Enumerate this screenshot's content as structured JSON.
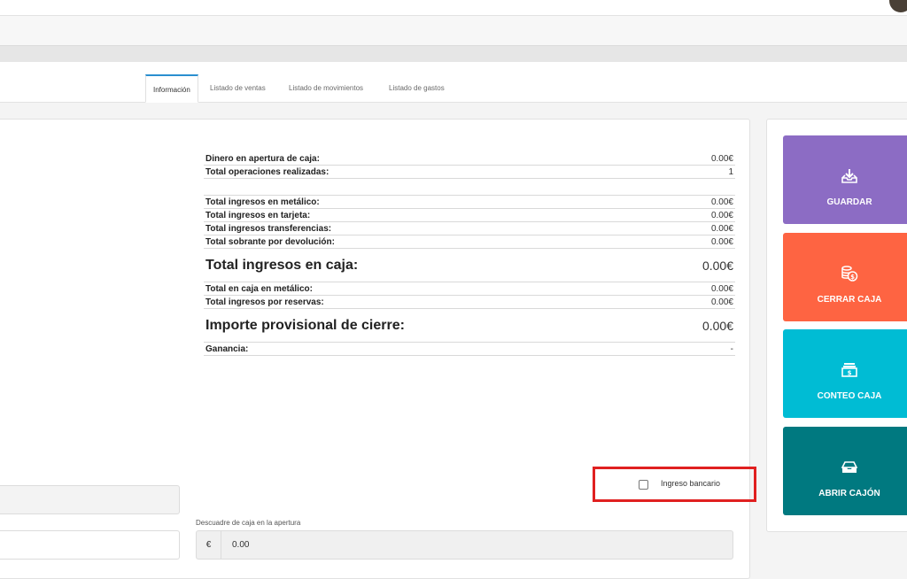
{
  "tabs": [
    {
      "label": "Información"
    },
    {
      "label": "Listado de ventas"
    },
    {
      "label": "Listado de movimientos"
    },
    {
      "label": "Listado de gastos"
    }
  ],
  "stats": {
    "apertura": {
      "label": "Dinero en apertura de caja:",
      "value": "0.00€"
    },
    "operaciones": {
      "label": "Total operaciones realizadas:",
      "value": "1"
    },
    "metalico": {
      "label": "Total ingresos en metálico:",
      "value": "0.00€"
    },
    "tarjeta": {
      "label": "Total ingresos en tarjeta:",
      "value": "0.00€"
    },
    "transferencias": {
      "label": "Total ingresos transferencias:",
      "value": "0.00€"
    },
    "sobrante": {
      "label": "Total sobrante por devolución:",
      "value": "0.00€"
    },
    "total_caja": {
      "label": "Total ingresos en caja:",
      "value": "0.00€"
    },
    "caja_metalico": {
      "label": "Total en caja en metálico:",
      "value": "0.00€"
    },
    "reservas": {
      "label": "Total ingresos por reservas:",
      "value": "0.00€"
    },
    "provisional": {
      "label": "Importe provisional de cierre:",
      "value": "0.00€"
    },
    "ganancia": {
      "label": "Ganancia:",
      "value": "-"
    }
  },
  "actions": {
    "guardar": "GUARDAR",
    "cerrar": "CERRAR CAJA",
    "conteo": "CONTEO CAJA",
    "abrir": "ABRIR CAJÓN"
  },
  "form": {
    "ingreso_bancario_label": "Ingreso bancario",
    "descuadre_label": "Descuadre de caja en la apertura",
    "currency_symbol": "€",
    "descuadre_value": "0.00"
  },
  "colors": {
    "guardar": "#8c6cc4",
    "cerrar": "#fe6442",
    "conteo": "#00bcd4",
    "abrir": "#007980",
    "highlight": "#e02020",
    "tab_active": "#2a8fd0"
  }
}
